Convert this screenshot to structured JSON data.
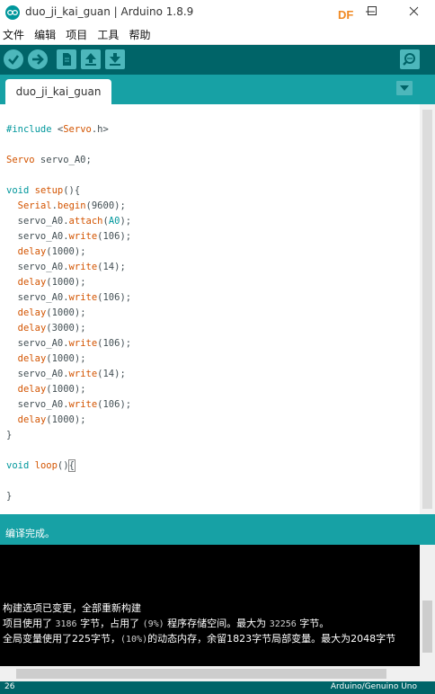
{
  "window": {
    "title": "duo_ji_kai_guan | Arduino 1.8.9",
    "badge": "DF"
  },
  "menu": [
    "文件",
    "编辑",
    "项目",
    "工具",
    "帮助"
  ],
  "tab": {
    "label": "duo_ji_kai_guan"
  },
  "code": [
    "#include <Servo.h>",
    "",
    "Servo servo_A0;",
    "",
    "void setup(){",
    "  Serial.begin(9600);",
    "  servo_A0.attach(A0);",
    "  servo_A0.write(106);",
    "  delay(1000);",
    "  servo_A0.write(14);",
    "  delay(1000);",
    "  servo_A0.write(106);",
    "  delay(1000);",
    "  delay(3000);",
    "  servo_A0.write(106);",
    "  delay(1000);",
    "  servo_A0.write(14);",
    "  delay(1000);",
    "  servo_A0.write(106);",
    "  delay(1000);",
    "}",
    "",
    "void loop(){",
    "",
    "}"
  ],
  "status": "编译完成。",
  "console": {
    "line1": "构建选项已变更，全部重新构建",
    "line2": {
      "a": "项目使用了 ",
      "n1": "3186",
      "b": " 字节，占用了 ",
      "n2": "(9%)",
      "c": " 程序存储空间。最大为 ",
      "n3": "32256",
      "d": " 字节。"
    },
    "line3": {
      "a": "全局变量使用了225字节，",
      "n1": "(10%)",
      "b": "的动态内存，余留1823字节局部变量。最大为2048字节"
    }
  },
  "footer": {
    "line_number": "26",
    "board": "Arduino/Genuino Uno"
  },
  "colors": {
    "toolbar": "#006468",
    "teal": "#17a1a5",
    "keyword": "#00979c",
    "function": "#d35400"
  },
  "icons": [
    "arduino-logo-icon",
    "minimize-icon",
    "maximize-icon",
    "close-icon",
    "verify-icon",
    "upload-icon",
    "new-icon",
    "open-icon",
    "save-icon",
    "serial-monitor-icon",
    "tab-menu-icon"
  ]
}
